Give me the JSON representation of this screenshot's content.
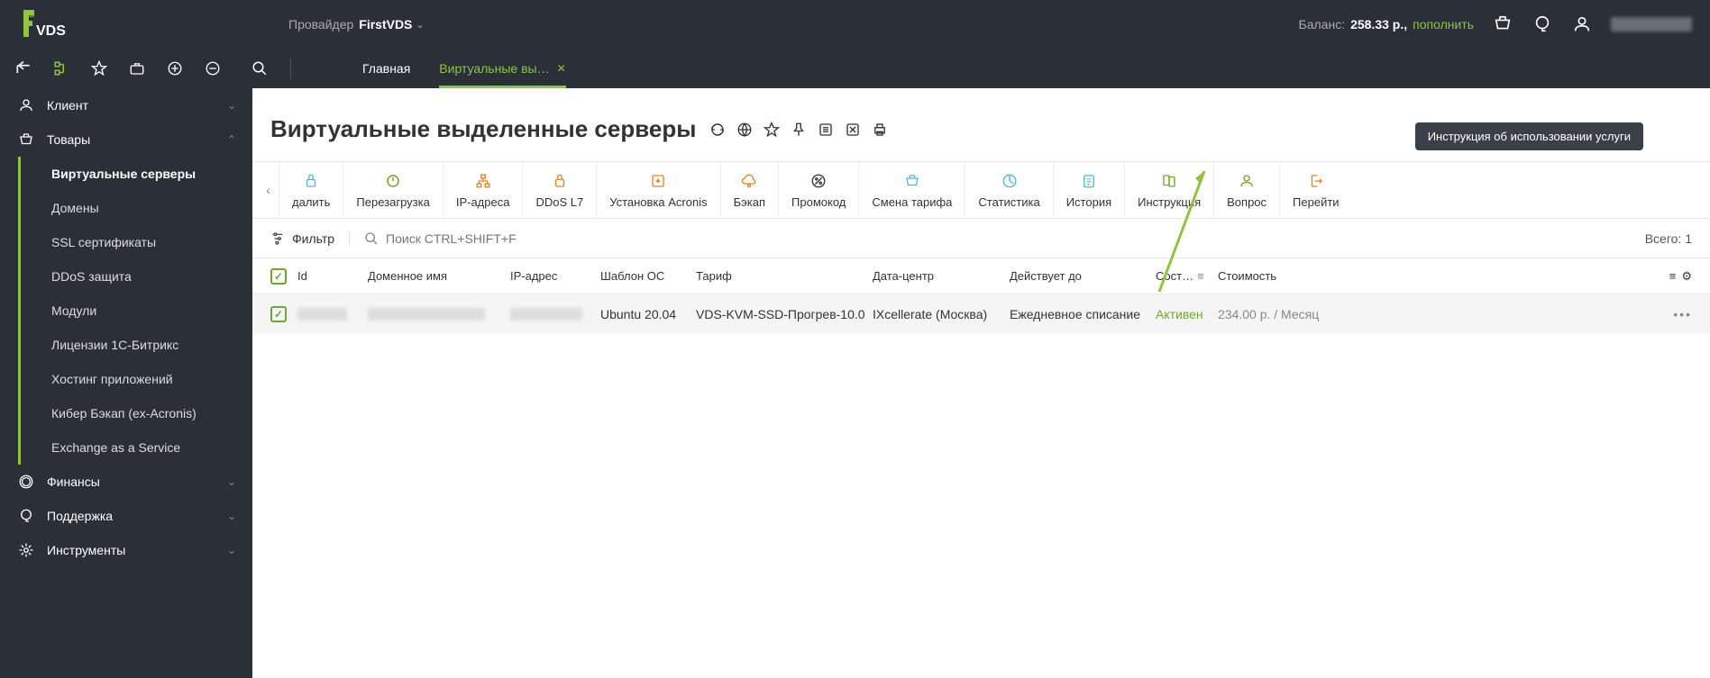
{
  "header": {
    "provider_label": "Провайдер",
    "provider_name": "FirstVDS",
    "balance_label": "Баланс:",
    "balance_value": "258.33 р.,",
    "balance_topup": "пополнить"
  },
  "tabs": {
    "main": "Главная",
    "active": "Виртуальные вы…"
  },
  "sidebar": {
    "client": "Клиент",
    "goods": "Товары",
    "goods_items": [
      "Виртуальные серверы",
      "Домены",
      "SSL сертификаты",
      "DDoS защита",
      "Модули",
      "Лицензии 1С-Битрикс",
      "Хостинг приложений",
      "Кибер Бэкап (ex-Acronis)",
      "Exchange as a Service"
    ],
    "finance": "Финансы",
    "support": "Поддержка",
    "tools": "Инструменты"
  },
  "page": {
    "title": "Виртуальные выделенные серверы"
  },
  "actions": {
    "delete": "далить",
    "reboot": "Перезагрузка",
    "ip": "IP-адреса",
    "ddos": "DDoS L7",
    "acronis": "Установка Acronis",
    "backup": "Бэкап",
    "promo": "Промокод",
    "tariff": "Смена тарифа",
    "stats": "Статистика",
    "history": "История",
    "manual": "Инструкция",
    "question": "Вопрос",
    "goto": "Перейти"
  },
  "tooltip": "Инструкция об использовании услуги",
  "filter": {
    "label": "Фильтр",
    "search_placeholder": "Поиск CTRL+SHIFT+F",
    "total": "Всего: 1"
  },
  "table": {
    "headers": {
      "id": "Id",
      "domain": "Доменное имя",
      "ip": "IP-адрес",
      "os": "Шаблон ОС",
      "tariff": "Тариф",
      "dc": "Дата-центр",
      "expires": "Действует до",
      "status": "Сост…",
      "cost": "Стоимость"
    },
    "row": {
      "os": "Ubuntu 20.04",
      "tariff": "VDS-KVM-SSD-Прогрев-10.0",
      "dc": "IXcellerate (Москва)",
      "expires": "Ежедневное списание",
      "status": "Активен",
      "cost": "234.00 р. / Месяц"
    }
  }
}
